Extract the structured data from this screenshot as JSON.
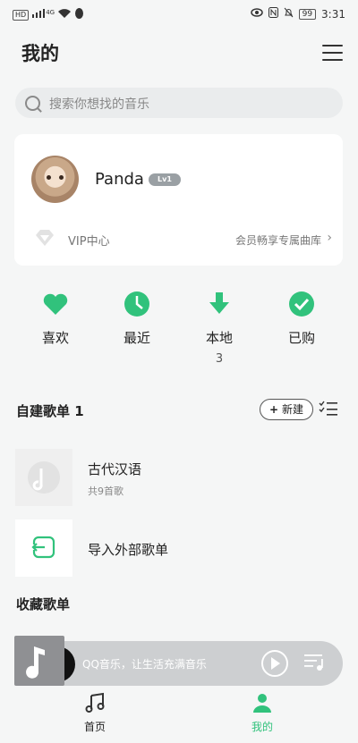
{
  "status_bar": {
    "left_chip": "HD",
    "net_label": "4G",
    "battery": "99",
    "time": "3:31"
  },
  "header": {
    "title": "我的"
  },
  "search": {
    "placeholder": "搜索你想找的音乐"
  },
  "profile": {
    "username": "Panda",
    "level": "Lv1",
    "vip_label": "VIP中心",
    "vip_desc": "会员畅享专属曲库"
  },
  "quick_actions": [
    {
      "label": "喜欢",
      "icon": "heart-icon"
    },
    {
      "label": "最近",
      "icon": "clock-icon"
    },
    {
      "label": "本地",
      "icon": "download-icon",
      "count": "3"
    },
    {
      "label": "已购",
      "icon": "check-icon"
    }
  ],
  "playlists_section": {
    "title": "自建歌单 1",
    "new_label": "新建"
  },
  "playlists": [
    {
      "name": "古代汉语",
      "subtitle": "共9首歌"
    }
  ],
  "import": {
    "label": "导入外部歌单"
  },
  "collected": {
    "title": "收藏歌单"
  },
  "player": {
    "text": "QQ音乐，让生活充满音乐"
  },
  "tabbar": [
    {
      "label": "首页"
    },
    {
      "label": "我的"
    }
  ],
  "colors": {
    "accent": "#31c27c"
  }
}
